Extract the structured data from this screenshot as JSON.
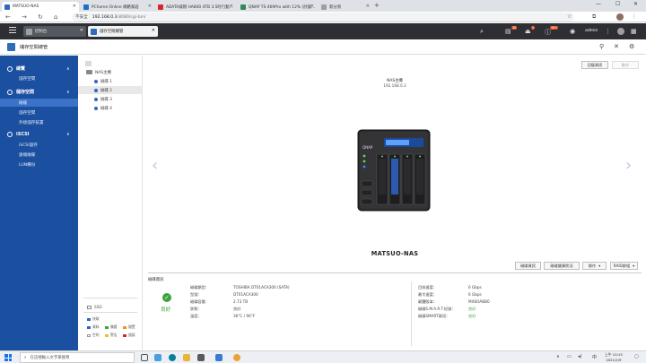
{
  "browser": {
    "tabs": [
      {
        "label": "MATSUO-NAS",
        "color": "#2e66c4",
        "active": true
      },
      {
        "label": "PChome Online 網路家庭",
        "color": "#1f6fc5"
      },
      {
        "label": "ADATA威剛 HA800 4TB 3.5吋行動…",
        "color": "#d9262c"
      },
      {
        "label": "QNAP TS-469Pro with 12% (討論…",
        "color": "#2e8b57"
      },
      {
        "label": "新分頁",
        "color": "#9e9e9e"
      }
    ],
    "insecure_label": "不安全",
    "url_host": "192.168.0.3",
    "url_path": ":8080/cgi-bin/"
  },
  "qts": {
    "tabs": [
      {
        "label": "控制台"
      },
      {
        "label": "儲存空間總管"
      }
    ],
    "badges": [
      "10",
      "1",
      "10+"
    ],
    "user": "admin"
  },
  "app": {
    "title": "儲存空間總管"
  },
  "sidebar": {
    "sections": [
      {
        "label": "總覽",
        "items": [
          "儲存空間"
        ]
      },
      {
        "label": "儲存空間",
        "items": [
          "磁碟",
          "儲存空間",
          "外接儲存裝置"
        ]
      },
      {
        "label": "iSCSI",
        "items": [
          "iSCSI儲存",
          "遠端磁碟",
          "LUN備份"
        ]
      }
    ]
  },
  "tree": {
    "root": "NAS主機",
    "disks": [
      "磁碟 1",
      "磁碟 2",
      "磁碟 3",
      "磁碟 4"
    ],
    "legend_title": "SSD",
    "legend_group": "快取",
    "legend": [
      {
        "label": "資料",
        "color": "#2e66c4"
      },
      {
        "label": "備援",
        "color": "#3ba33b"
      },
      {
        "label": "閒置",
        "color": "#e8962a"
      },
      {
        "label": "空的",
        "color": "#ffffff"
      },
      {
        "label": "警告",
        "color": "#e6c42a"
      },
      {
        "label": "錯誤",
        "color": "#d9262c"
      }
    ]
  },
  "main": {
    "btn_recover": "回復資訊",
    "btn_settings": "動作",
    "nas_header": "NAS主機",
    "nas_ip": "192.168.0.3",
    "nas_name": "MATSUO-NAS",
    "btn_disk_info": "磁碟資訊",
    "btn_disk_health": "磁碟健康狀況",
    "btn_action": "操作",
    "btn_raid": "RAID群組",
    "info_title": "磁碟資訊",
    "status": "良好",
    "left_labels": [
      "磁碟類型：",
      "型號：",
      "磁碟容量：",
      "狀態：",
      "溫度："
    ],
    "left_values": [
      "TOSHIBA DT01ACA300 (SATA)",
      "DT01ACA300",
      "2.73 TB",
      "良好",
      "36°C / 96°F"
    ],
    "right_labels": [
      "目前速度：",
      "最大速度：",
      "韌體版本：",
      "磁碟S.M.A.R.T.紀錄：",
      "磁碟SMART資訊："
    ],
    "right_values": [
      "6 Gbps",
      "6 Gbps",
      "MX6OABB0",
      "良好",
      "良好"
    ]
  },
  "taskbar": {
    "search_placeholder": "在這裡輸入文字來搜尋",
    "time": "上午 10:15",
    "date": "2021/1/9"
  }
}
